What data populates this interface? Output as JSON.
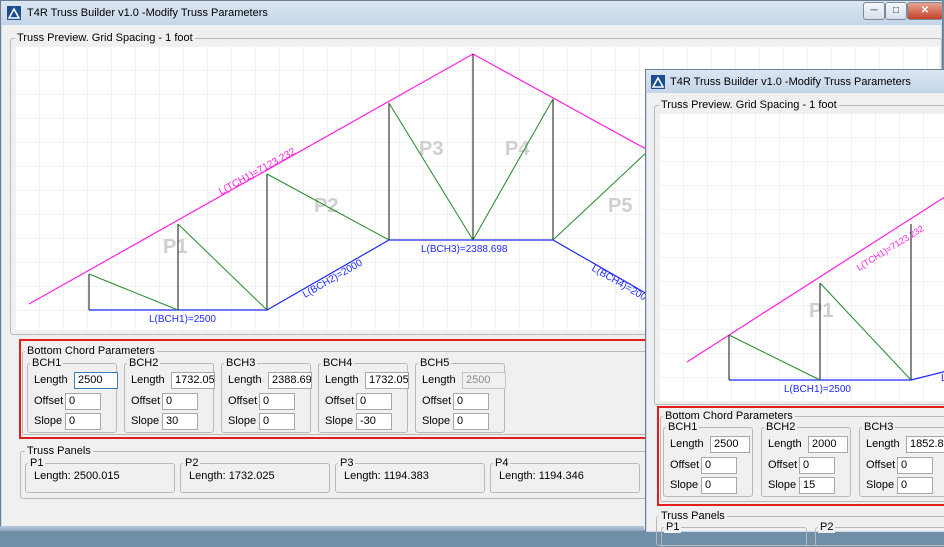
{
  "colors": {
    "top_chord": "#ff1fe0",
    "bottom_chord": "#1f28ff",
    "web": "#22882b",
    "vertical": "#111111",
    "highlight": "#e31c1c",
    "panel_label": "#c8c8c8"
  },
  "main": {
    "title": "T4R Truss Builder v1.0 -Modify Truss Parameters",
    "icon": "truss-app-icon",
    "window_controls": {
      "minimize": "─",
      "maximize": "□",
      "close": "✕"
    },
    "preview": {
      "label": "Truss Preview. Grid Spacing - 1 foot",
      "panel_labels": [
        "P1",
        "P2",
        "P3",
        "P4",
        "P5"
      ],
      "tch_label": "L(TCH1)=7123.232",
      "bch_labels": [
        "L(BCH1)=2500",
        "L(BCH2)=2000",
        "L(BCH3)=2388.698",
        "L(BCH4)=2000"
      ]
    },
    "bottom_chord": {
      "label": "Bottom Chord Parameters",
      "length_label": "Length",
      "offset_label": "Offset",
      "slope_label": "Slope",
      "chords": [
        {
          "name": "BCH1",
          "length": "2500",
          "offset": "0",
          "slope": "0"
        },
        {
          "name": "BCH2",
          "length": "1732.051",
          "offset": "0",
          "slope": "30"
        },
        {
          "name": "BCH3",
          "length": "2388.698",
          "offset": "0",
          "slope": "0"
        },
        {
          "name": "BCH4",
          "length": "1732.051",
          "offset": "0",
          "slope": "-30"
        },
        {
          "name": "BCH5",
          "length": "2500",
          "offset": "0",
          "slope": "0"
        }
      ]
    },
    "truss_panels": {
      "label": "Truss Panels",
      "length_prefix": "Length:",
      "panels": [
        {
          "name": "P1",
          "length": "2500.015"
        },
        {
          "name": "P2",
          "length": "1732.025"
        },
        {
          "name": "P3",
          "length": "1194.383"
        },
        {
          "name": "P4",
          "length": "1194.346"
        }
      ],
      "clipped_panel": {
        "name": "P",
        "prefix": "L"
      }
    }
  },
  "second": {
    "title": "T4R Truss Builder v1.0 -Modify Truss Parameters",
    "preview": {
      "label": "Truss Preview. Grid Spacing - 1 foot",
      "panel_label": "P1",
      "tch_label": "L(TCH1)=7123.232",
      "bch_label": "L(BCH1)=2500",
      "clipped_label": "L("
    },
    "bottom_chord": {
      "label": "Bottom Chord Parameters",
      "length_label": "Length",
      "offset_label": "Offset",
      "slope_label": "Slope",
      "chords": [
        {
          "name": "BCH1",
          "length": "2500",
          "offset": "0",
          "slope": "0"
        },
        {
          "name": "BCH2",
          "length": "2000",
          "offset": "0",
          "slope": "15"
        },
        {
          "name": "BCH3",
          "length": "1852.8",
          "offset": "0",
          "slope": "0"
        }
      ]
    },
    "truss_panels": {
      "label": "Truss Panels",
      "panels": [
        {
          "name": "P1"
        },
        {
          "name": "P2"
        }
      ]
    }
  }
}
